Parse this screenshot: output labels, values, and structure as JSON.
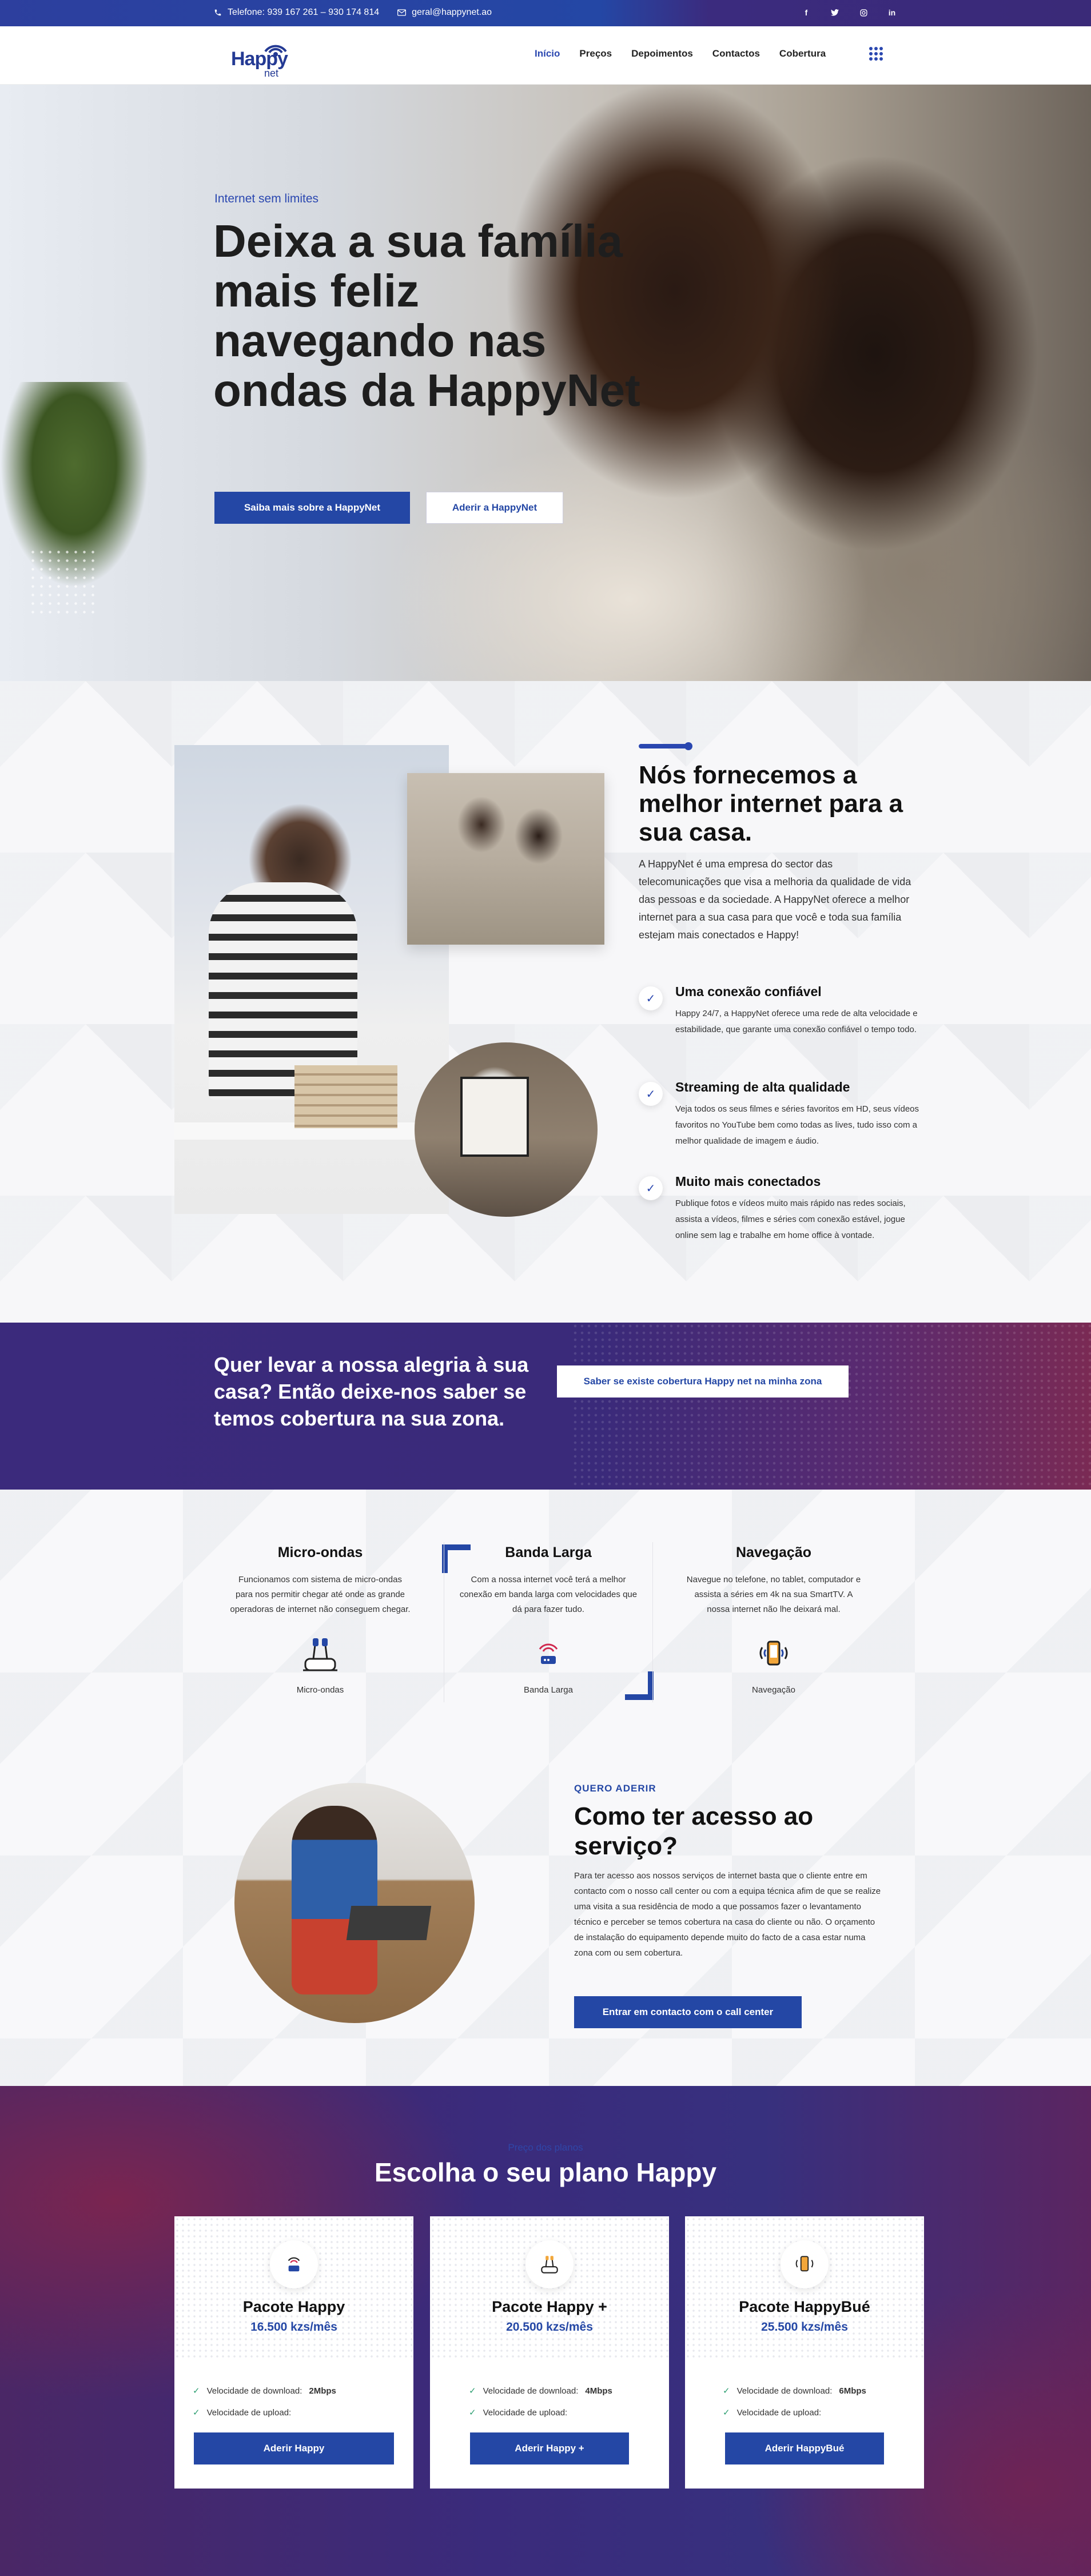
{
  "topbar": {
    "phone": "Telefone: 939 167 261 – 930 174 814",
    "email": "geral@happynet.ao"
  },
  "header": {
    "logo_text": "Happy",
    "logo_sub": "net",
    "nav": [
      "Início",
      "Preços",
      "Depoimentos",
      "Contactos",
      "Cobertura"
    ]
  },
  "hero": {
    "eyebrow": "Internet sem limites",
    "title": "Deixa a sua família mais feliz navegando nas ondas da HappyNet",
    "primary_button": "Saiba mais sobre a HappyNet",
    "secondary_button": "Aderir a HappyNet"
  },
  "about": {
    "title": "Nós fornecemos a melhor internet para a sua casa.",
    "lead": "A HappyNet é uma empresa do sector das telecomunicações que visa a melhoria da qualidade de vida das pessoas e da sociedade. A HappyNet oferece a melhor internet para a sua casa para que você e toda sua família estejam mais conectados e Happy!",
    "features": [
      {
        "title": "Uma conexão confiável",
        "text": "Happy 24/7, a HappyNet oferece uma rede de alta velocidade e estabilidade, que garante uma conexão confiável o tempo todo."
      },
      {
        "title": "Streaming de alta qualidade",
        "text": "Veja todos os seus filmes e séries favoritos em HD, seus vídeos favoritos no YouTube bem como todas as lives, tudo isso com a melhor qualidade de imagem e áudio."
      },
      {
        "title": "Muito mais conectados",
        "text": "Publique fotos e vídeos muito mais rápido nas redes sociais, assista a vídeos, filmes e séries com conexão estável, jogue online sem lag e trabalhe em home office à vontade."
      }
    ]
  },
  "cta": {
    "title": "Quer levar a nossa alegria à sua casa? Então deixe-nos saber se temos cobertura na sua zona.",
    "button": "Saber se existe cobertura Happy net na minha zona"
  },
  "services": [
    {
      "title": "Micro-ondas",
      "text": "Funcionamos com sistema de micro-ondas para nos permitir chegar até onde as grande operadoras de internet não conseguem chegar.",
      "icon": "microwave-antenna-icon",
      "label": "Micro-ondas"
    },
    {
      "title": "Banda Larga",
      "text": "Com a nossa internet você terá a melhor conexão em banda larga com velocidades que dá para fazer tudo.",
      "icon": "broadband-router-icon",
      "label": "Banda Larga"
    },
    {
      "title": "Navegação",
      "text": "Navegue no telefone, no tablet, computador e assista a séries em 4k na sua SmartTV. A nossa internet não lhe deixará mal.",
      "icon": "mobile-signal-icon",
      "label": "Navegação"
    }
  ],
  "access": {
    "eyebrow": "QUERO ADERIR",
    "title": "Como ter acesso ao serviço?",
    "text": "Para ter acesso aos nossos serviços de internet basta que o cliente entre em contacto com o nosso call center ou com a equipa técnica afim de que se realize uma visita a sua residência de modo a que possamos fazer o levantamento técnico e perceber se temos cobertura na casa do cliente ou não. O orçamento de instalação do equipamento depende muito do facto de a casa estar numa zona com ou sem cobertura.",
    "button": "Entrar em contacto com o call center"
  },
  "plans": {
    "eyebrow": "Preço dos planos",
    "title": "Escolha o seu plano Happy",
    "cards": [
      {
        "name": "Pacote Happy",
        "price": "16.500 kzs/mês",
        "download_label": "Velocidade de download:",
        "download": "2Mbps",
        "upload_label": "Velocidade de upload:",
        "button": "Aderir Happy"
      },
      {
        "name": "Pacote Happy +",
        "price": "20.500 kzs/mês",
        "download_label": "Velocidade de download:",
        "download": "4Mbps",
        "upload_label": "Velocidade de upload:",
        "button": "Aderir Happy +"
      },
      {
        "name": "Pacote HappyBué",
        "price": "25.500 kzs/mês",
        "download_label": "Velocidade de download:",
        "download": "6Mbps",
        "upload_label": "Velocidade de upload:",
        "button": "Aderir HappyBué"
      }
    ]
  },
  "colors": {
    "brand": "#2447a5",
    "purple": "#3a2a7a"
  }
}
